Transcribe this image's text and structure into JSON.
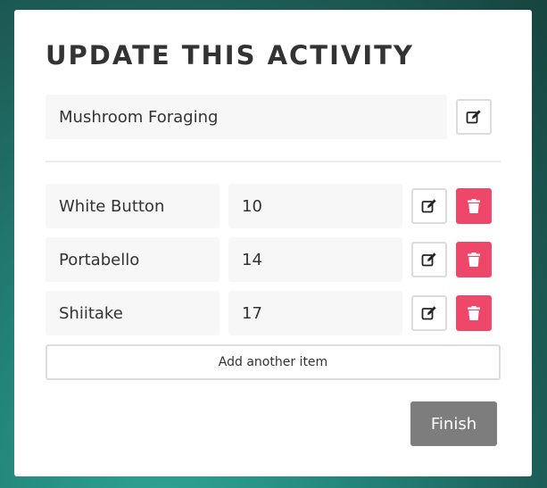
{
  "card": {
    "title": "UPDATE THIS ACTIVITY",
    "activity_name": "Mushroom Foraging"
  },
  "items": [
    {
      "name": "White Button",
      "value": "10"
    },
    {
      "name": "Portabello",
      "value": "14"
    },
    {
      "name": "Shiitake",
      "value": "17"
    }
  ],
  "actions": {
    "add_label": "Add another item",
    "finish_label": "Finish"
  },
  "icons": {
    "edit": "edit-icon",
    "delete": "trash-icon"
  },
  "colors": {
    "delete": "#ef4769",
    "finish": "#7d7d7d"
  }
}
